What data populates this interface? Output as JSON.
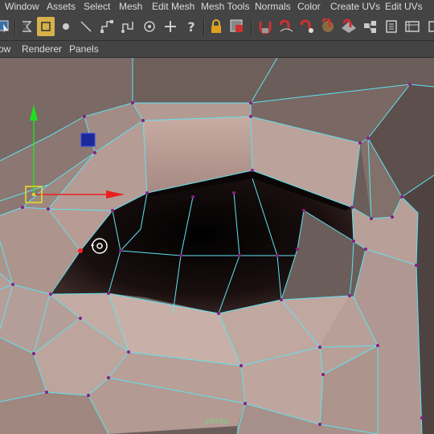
{
  "menubar": {
    "items": [
      "Window",
      "Assets",
      "Select",
      "Mesh",
      "Edit Mesh",
      "Mesh Tools",
      "Normals",
      "Color",
      "Create UVs",
      "Edit UVs"
    ]
  },
  "shelf": {
    "tools": [
      "select-tool-icon",
      "lasso-tool-icon",
      "paint-select-icon",
      "move-tool-icon",
      "rotate-tool-icon",
      "scale-tool-icon",
      "soft-mod-icon",
      "show-manipulator-icon",
      "help-icon",
      "lock-icon",
      "snap-icon",
      "magnet-snap-icon",
      "snap-curve-icon",
      "snap-point-icon",
      "snap-view-icon",
      "snap-surface-icon",
      "render-icon",
      "uv-editor-icon",
      "settings-icon"
    ]
  },
  "panel_menu": {
    "items": [
      "ow",
      "Renderer",
      "Panels"
    ]
  },
  "viewport": {
    "camera_label": "persp",
    "colors": {
      "mesh_face": "#b89b94",
      "wireframe": "#5fe3f0",
      "vertex": "#8a1d86",
      "cavity": "#120a0a",
      "background": "#6b5e5a",
      "axis_x": "#e82020",
      "axis_y": "#20e020",
      "axis_z": "#2030c8",
      "manip_center": "#e8e020"
    }
  }
}
